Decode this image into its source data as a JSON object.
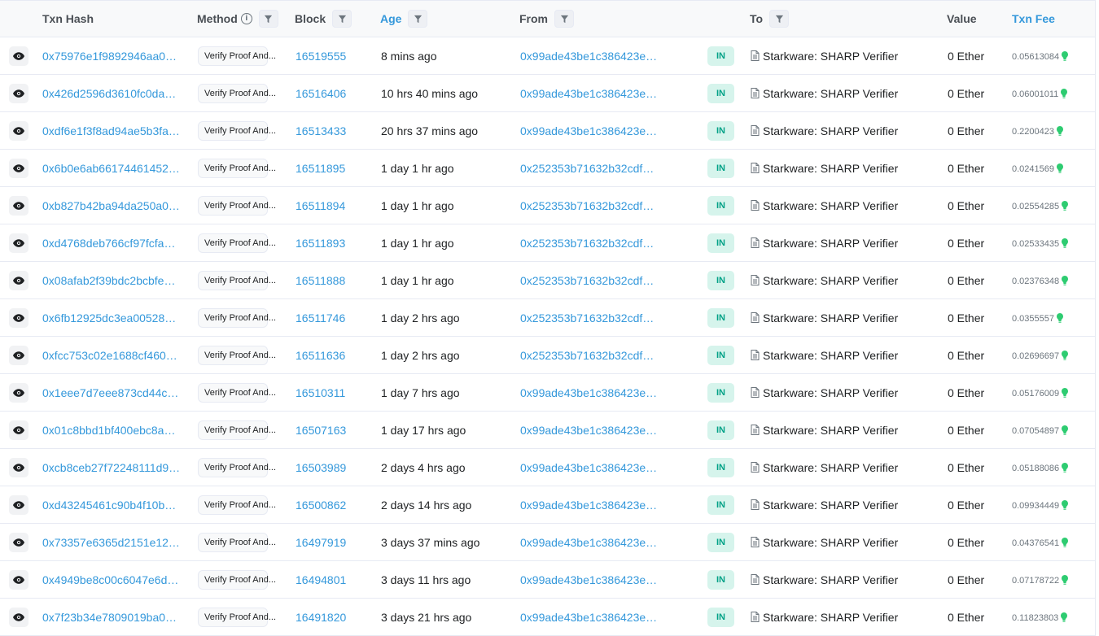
{
  "columns": {
    "txn_hash": "Txn Hash",
    "method": "Method",
    "block": "Block",
    "age": "Age",
    "from": "From",
    "to": "To",
    "value": "Value",
    "txn_fee": "Txn Fee"
  },
  "icons": {
    "info": "info-icon",
    "filter": "filter-icon",
    "view": "eye-icon",
    "contract": "contract-document-icon",
    "gas": "gas-bulb-icon"
  },
  "colors": {
    "link": "#3498db",
    "in_badge_bg": "#d6f4ec",
    "in_badge_text": "#00a186",
    "gas_green": "#2ecc71"
  },
  "rows": [
    {
      "hash": "0x75976e1f9892946aa0…",
      "method": "Verify Proof And...",
      "block": "16519555",
      "age": "8 mins ago",
      "from": "0x99ade43be1c386423e…",
      "dir": "IN",
      "to": "Starkware: SHARP Verifier",
      "value": "0 Ether",
      "fee": "0.05613084"
    },
    {
      "hash": "0x426d2596d3610fc0da…",
      "method": "Verify Proof And...",
      "block": "16516406",
      "age": "10 hrs 40 mins ago",
      "from": "0x99ade43be1c386423e…",
      "dir": "IN",
      "to": "Starkware: SHARP Verifier",
      "value": "0 Ether",
      "fee": "0.06001011"
    },
    {
      "hash": "0xdf6e1f3f8ad94ae5b3fa…",
      "method": "Verify Proof And...",
      "block": "16513433",
      "age": "20 hrs 37 mins ago",
      "from": "0x99ade43be1c386423e…",
      "dir": "IN",
      "to": "Starkware: SHARP Verifier",
      "value": "0 Ether",
      "fee": "0.2200423"
    },
    {
      "hash": "0x6b0e6ab66174461452…",
      "method": "Verify Proof And...",
      "block": "16511895",
      "age": "1 day 1 hr ago",
      "from": "0x252353b71632b32cdf…",
      "dir": "IN",
      "to": "Starkware: SHARP Verifier",
      "value": "0 Ether",
      "fee": "0.0241569"
    },
    {
      "hash": "0xb827b42ba94da250a0…",
      "method": "Verify Proof And...",
      "block": "16511894",
      "age": "1 day 1 hr ago",
      "from": "0x252353b71632b32cdf…",
      "dir": "IN",
      "to": "Starkware: SHARP Verifier",
      "value": "0 Ether",
      "fee": "0.02554285"
    },
    {
      "hash": "0xd4768deb766cf97fcfa…",
      "method": "Verify Proof And...",
      "block": "16511893",
      "age": "1 day 1 hr ago",
      "from": "0x252353b71632b32cdf…",
      "dir": "IN",
      "to": "Starkware: SHARP Verifier",
      "value": "0 Ether",
      "fee": "0.02533435"
    },
    {
      "hash": "0x08afab2f39bdc2bcbfe…",
      "method": "Verify Proof And...",
      "block": "16511888",
      "age": "1 day 1 hr ago",
      "from": "0x252353b71632b32cdf…",
      "dir": "IN",
      "to": "Starkware: SHARP Verifier",
      "value": "0 Ether",
      "fee": "0.02376348"
    },
    {
      "hash": "0x6fb12925dc3ea00528…",
      "method": "Verify Proof And...",
      "block": "16511746",
      "age": "1 day 2 hrs ago",
      "from": "0x252353b71632b32cdf…",
      "dir": "IN",
      "to": "Starkware: SHARP Verifier",
      "value": "0 Ether",
      "fee": "0.0355557"
    },
    {
      "hash": "0xfcc753c02e1688cf460…",
      "method": "Verify Proof And...",
      "block": "16511636",
      "age": "1 day 2 hrs ago",
      "from": "0x252353b71632b32cdf…",
      "dir": "IN",
      "to": "Starkware: SHARP Verifier",
      "value": "0 Ether",
      "fee": "0.02696697"
    },
    {
      "hash": "0x1eee7d7eee873cd44c…",
      "method": "Verify Proof And...",
      "block": "16510311",
      "age": "1 day 7 hrs ago",
      "from": "0x99ade43be1c386423e…",
      "dir": "IN",
      "to": "Starkware: SHARP Verifier",
      "value": "0 Ether",
      "fee": "0.05176009"
    },
    {
      "hash": "0x01c8bbd1bf400ebc8a…",
      "method": "Verify Proof And...",
      "block": "16507163",
      "age": "1 day 17 hrs ago",
      "from": "0x99ade43be1c386423e…",
      "dir": "IN",
      "to": "Starkware: SHARP Verifier",
      "value": "0 Ether",
      "fee": "0.07054897"
    },
    {
      "hash": "0xcb8ceb27f72248111d9…",
      "method": "Verify Proof And...",
      "block": "16503989",
      "age": "2 days 4 hrs ago",
      "from": "0x99ade43be1c386423e…",
      "dir": "IN",
      "to": "Starkware: SHARP Verifier",
      "value": "0 Ether",
      "fee": "0.05188086"
    },
    {
      "hash": "0xd43245461c90b4f10b…",
      "method": "Verify Proof And...",
      "block": "16500862",
      "age": "2 days 14 hrs ago",
      "from": "0x99ade43be1c386423e…",
      "dir": "IN",
      "to": "Starkware: SHARP Verifier",
      "value": "0 Ether",
      "fee": "0.09934449"
    },
    {
      "hash": "0x73357e6365d2151e12…",
      "method": "Verify Proof And...",
      "block": "16497919",
      "age": "3 days 37 mins ago",
      "from": "0x99ade43be1c386423e…",
      "dir": "IN",
      "to": "Starkware: SHARP Verifier",
      "value": "0 Ether",
      "fee": "0.04376541"
    },
    {
      "hash": "0x4949be8c00c6047e6d…",
      "method": "Verify Proof And...",
      "block": "16494801",
      "age": "3 days 11 hrs ago",
      "from": "0x99ade43be1c386423e…",
      "dir": "IN",
      "to": "Starkware: SHARP Verifier",
      "value": "0 Ether",
      "fee": "0.07178722"
    },
    {
      "hash": "0x7f23b34e7809019ba0…",
      "method": "Verify Proof And...",
      "block": "16491820",
      "age": "3 days 21 hrs ago",
      "from": "0x99ade43be1c386423e…",
      "dir": "IN",
      "to": "Starkware: SHARP Verifier",
      "value": "0 Ether",
      "fee": "0.11823803"
    }
  ]
}
